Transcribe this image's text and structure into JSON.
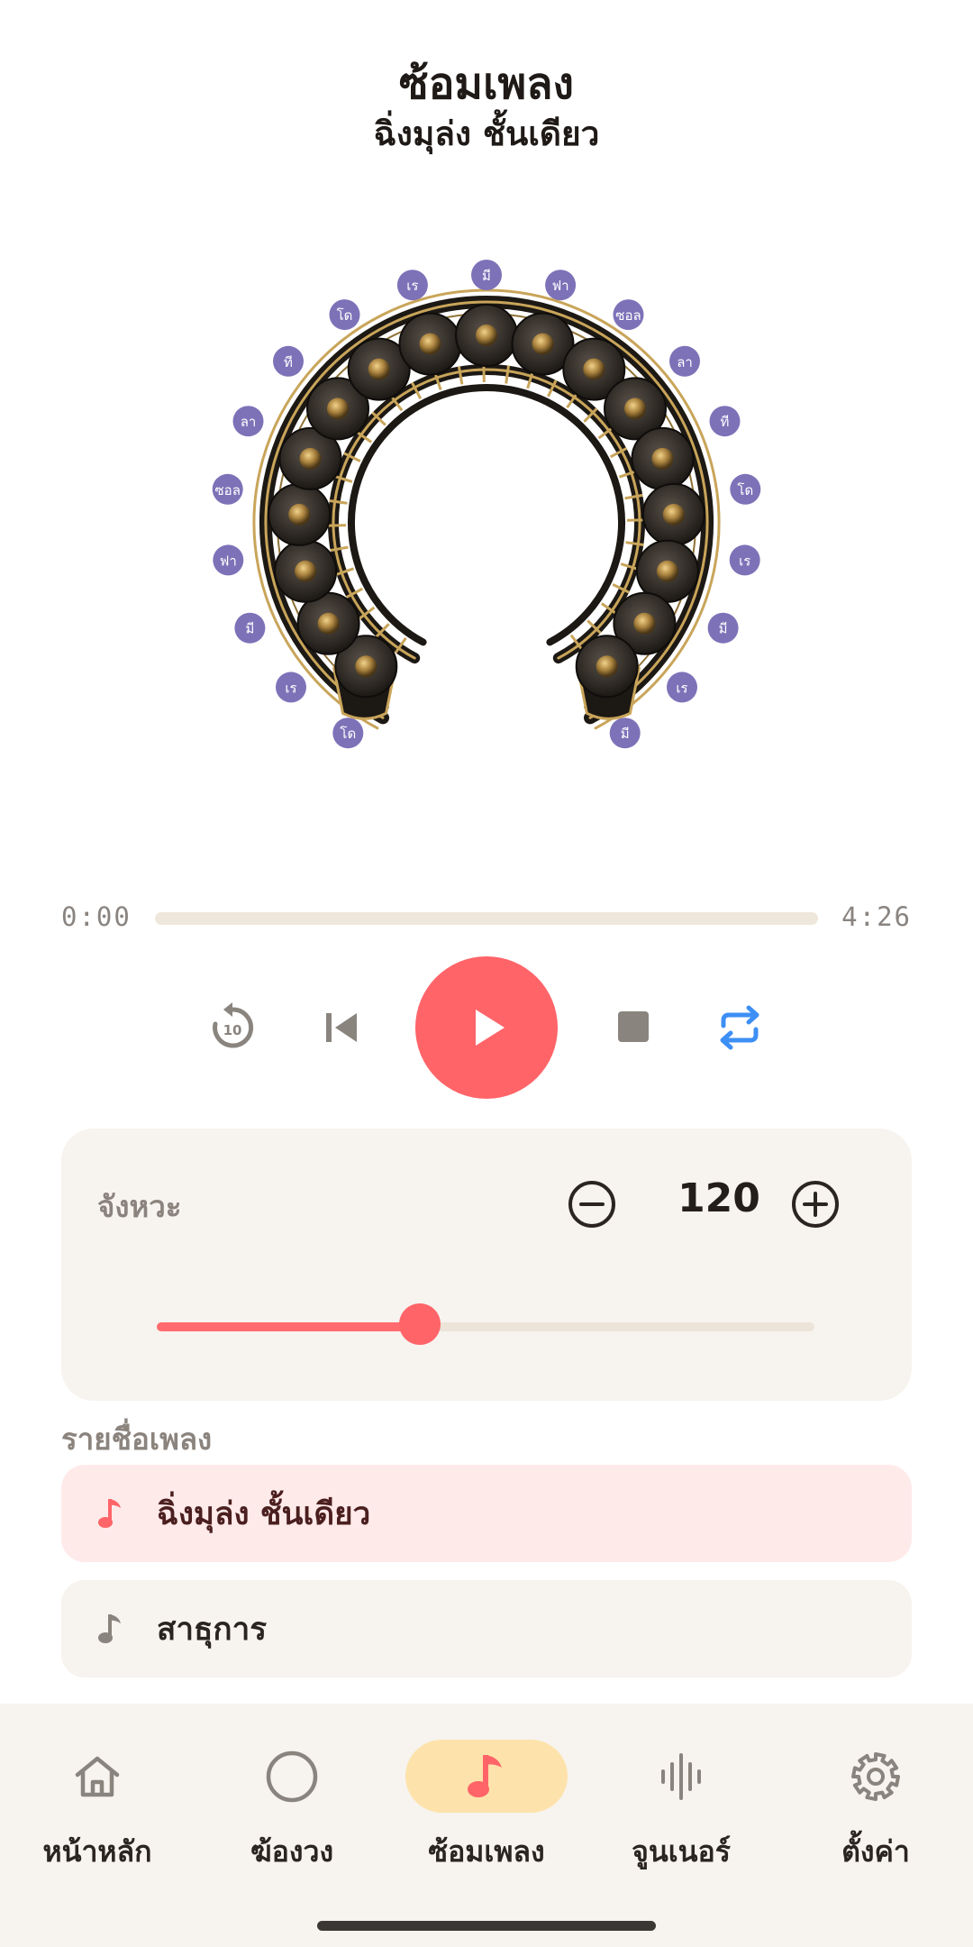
{
  "header": {
    "title": "ซ้อมเพลง",
    "subtitle": "ฉิ่งมุล่ง ชั้นเดียว"
  },
  "instrument": {
    "icon": "khong-wong-illustration",
    "note_labels": [
      "โด",
      "เร",
      "มี",
      "ฟา",
      "ซอล",
      "ลา",
      "ที",
      "โด",
      "เร",
      "มี",
      "ฟา",
      "ซอล",
      "ลา",
      "ที",
      "โด",
      "เร",
      "มี",
      "เร",
      "มี"
    ],
    "label_color": "#7d72b8"
  },
  "player": {
    "current_time": "0:00",
    "total_time": "4:26",
    "progress": 0,
    "buttons": {
      "replay10": "replay-10-icon",
      "previous": "skip-previous-icon",
      "play": "play-icon",
      "stop": "stop-icon",
      "repeat": "repeat-icon"
    },
    "accent_color": "#ff6469",
    "repeat_color": "#3d8ff5"
  },
  "tempo": {
    "label": "จังหวะ",
    "value": "120",
    "slider_fraction": 0.4
  },
  "song_list": {
    "title": "รายชื่อเพลง",
    "songs": [
      {
        "name": "ฉิ่งมุล่ง ชั้นเดียว",
        "active": true
      },
      {
        "name": "สาธุการ",
        "active": false
      }
    ]
  },
  "bottom_nav": {
    "items": [
      {
        "label": "หน้าหลัก",
        "icon": "home-icon"
      },
      {
        "label": "ฆ้องวง",
        "icon": "circle-icon"
      },
      {
        "label": "ซ้อมเพลง",
        "icon": "music-note-icon",
        "active": true
      },
      {
        "label": "จูนเนอร์",
        "icon": "waveform-icon"
      },
      {
        "label": "ตั้งค่า",
        "icon": "gear-icon"
      }
    ],
    "active_bg": "#fde3ab"
  }
}
